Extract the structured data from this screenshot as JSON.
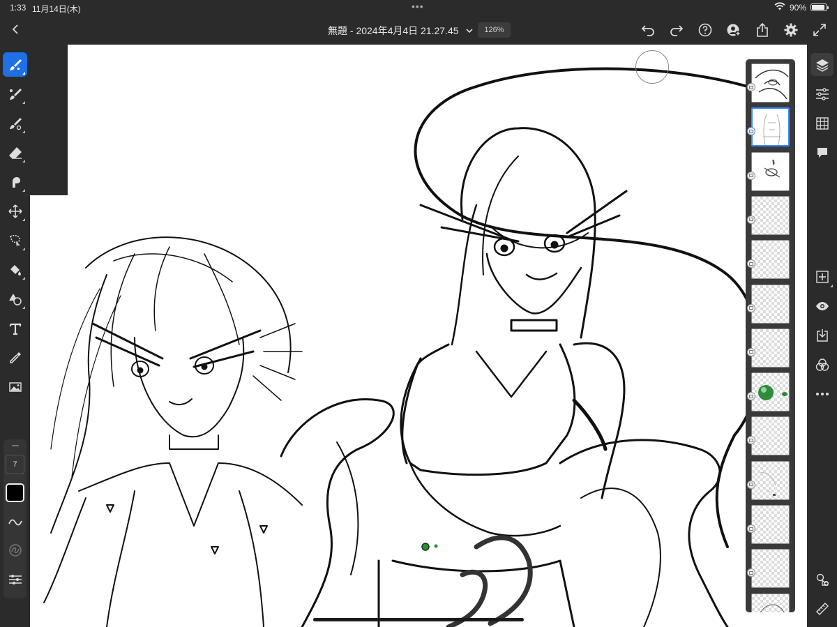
{
  "status_bar": {
    "time": "1:33",
    "date": "11月14日(木)",
    "more_dots": "•••",
    "battery_text": "90%",
    "battery_level": 0.9
  },
  "top_bar": {
    "back_icon": "chevron-left-icon",
    "title": "無題 - 2024年4月4日 21.27.45",
    "zoom": "126%",
    "actions": [
      "undo-icon",
      "redo-icon",
      "help-icon",
      "invite-icon",
      "share-icon",
      "settings-icon",
      "fullscreen-icon"
    ]
  },
  "left_toolbar": {
    "tools": [
      "pixel-brush-icon",
      "live-brush-icon",
      "vector-brush-icon",
      "eraser-icon",
      "smudge-icon",
      "transform-icon",
      "selection-icon",
      "fill-icon",
      "shapes-icon",
      "text-icon",
      "eyedropper-icon",
      "place-image-icon"
    ],
    "active_tool": "pixel-brush-icon",
    "brush_size": "7",
    "color": "#000000"
  },
  "layers": {
    "count": 13,
    "selected_index": 1
  },
  "right_toolbar": {
    "top_tools": [
      "layers-icon",
      "properties-icon",
      "grid-icon",
      "comment-icon"
    ],
    "layer_tools": [
      "add-layer-icon",
      "visibility-icon",
      "import-icon",
      "blend-icon",
      "more-icon"
    ],
    "bottom_tools": [
      "shapes-add-icon",
      "ruler-icon"
    ]
  },
  "colors": {
    "accent": "#1f6fe6",
    "ui_background": "#2b2b2b",
    "selected_layer_border": "#3d8bff"
  }
}
